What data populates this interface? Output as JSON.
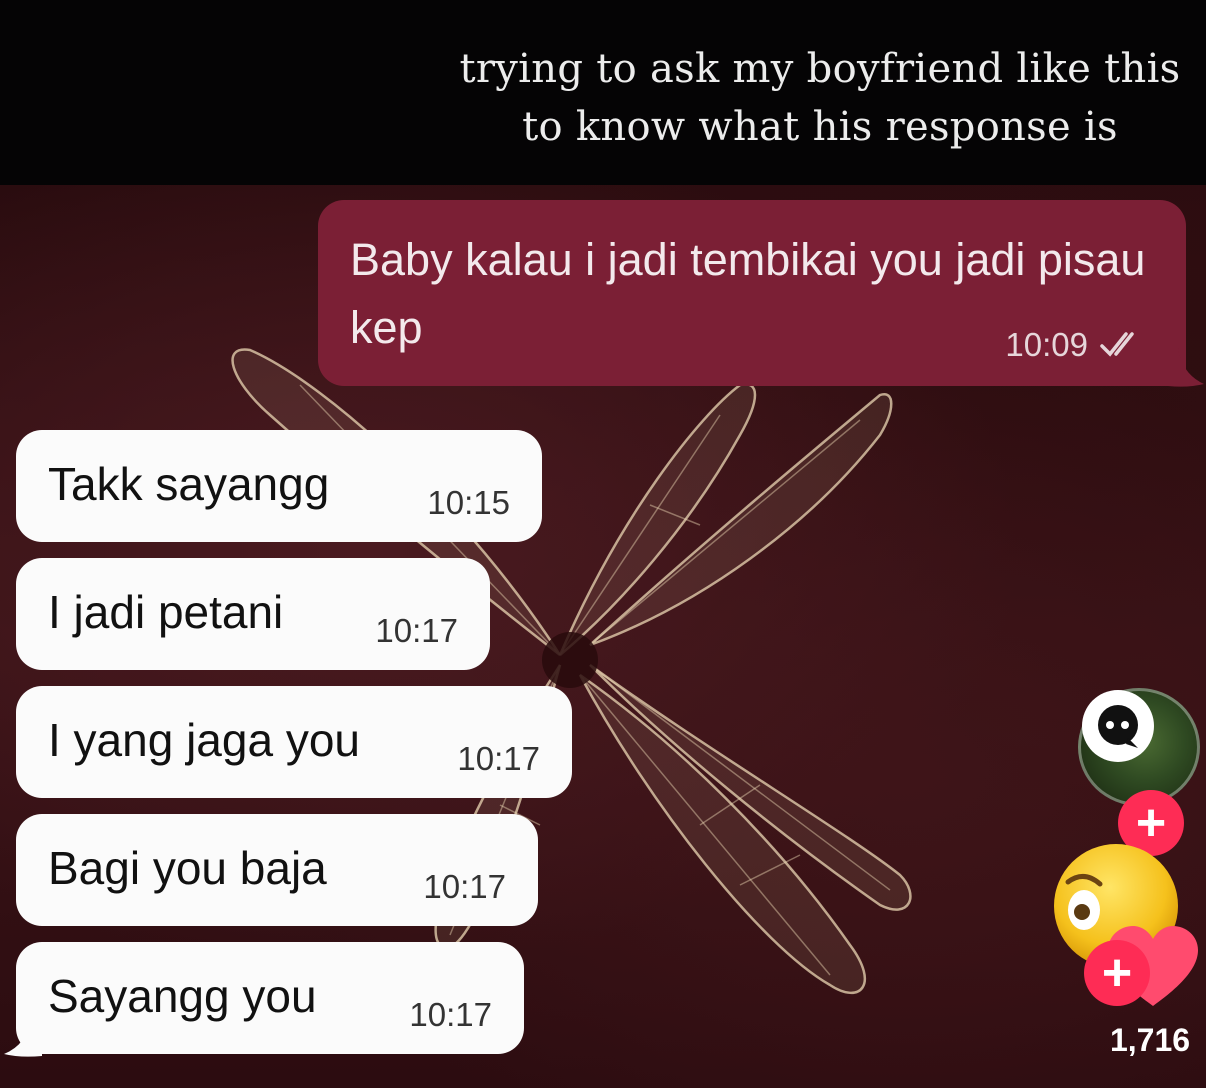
{
  "caption": {
    "line1": "trying to ask my boyfriend like this",
    "line2": "to know what his response is"
  },
  "outgoing": {
    "text": "Baby kalau i jadi tembikai you jadi pisau kep",
    "time": "10:09",
    "status_icon": "double-check-icon"
  },
  "incoming": [
    {
      "text": "Takk sayangg",
      "time": "10:15"
    },
    {
      "text": "I jadi petani",
      "time": "10:17"
    },
    {
      "text": "I yang jaga you",
      "time": "10:17"
    },
    {
      "text": "Bagi you baja",
      "time": "10:17"
    },
    {
      "text": "Sayangg you",
      "time": "10:17"
    }
  ],
  "sidebar": {
    "like_count": "1,716",
    "icons": [
      "chat-bubble-icon",
      "follow-plus-icon",
      "emoji-face-icon",
      "heart-icon"
    ]
  },
  "colors": {
    "outgoing_bubble": "#7b1f35",
    "incoming_bubble": "#fbfbfb",
    "accent_plus": "#fe2c55"
  }
}
